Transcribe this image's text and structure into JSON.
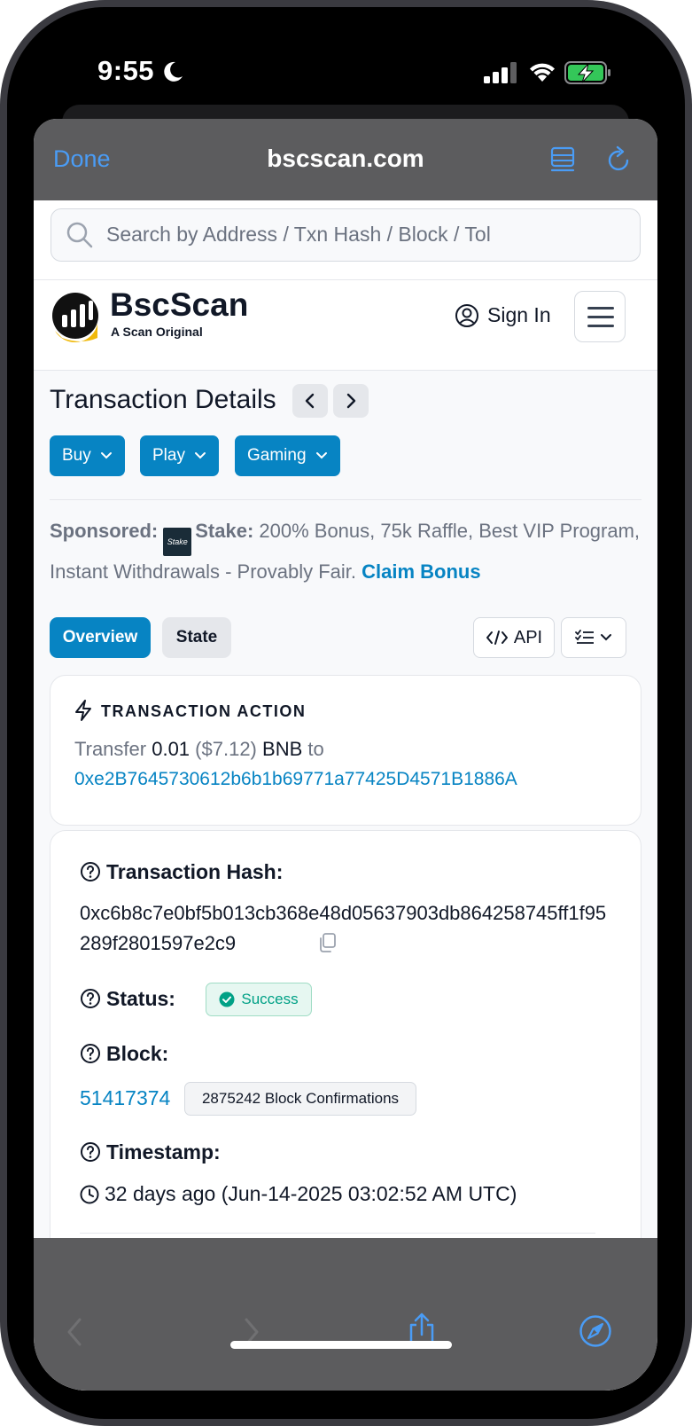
{
  "status_bar": {
    "time": "9:55"
  },
  "browser": {
    "done_label": "Done",
    "url": "bscscan.com"
  },
  "search": {
    "placeholder": "Search by Address / Txn Hash / Block / Tol"
  },
  "header": {
    "logo_title": "BscScan",
    "logo_subtitle": "A Scan Original",
    "sign_in_label": "Sign In"
  },
  "page": {
    "title": "Transaction Details",
    "menu_buttons": [
      {
        "label": "Buy"
      },
      {
        "label": "Play"
      },
      {
        "label": "Gaming"
      }
    ]
  },
  "sponsored": {
    "label": "Sponsored:",
    "brand": "Stake:",
    "logo_text": "Stake",
    "text": " 200% Bonus, 75k Raffle, Best VIP Program, Instant Withdrawals - Provably Fair. ",
    "cta": "Claim Bonus"
  },
  "tabs": {
    "overview": "Overview",
    "state": "State",
    "api": "API"
  },
  "transaction_action": {
    "title": "TRANSACTION ACTION",
    "verb": "Transfer",
    "amount": "0.01",
    "usd": "($7.12)",
    "token": "BNB",
    "to": "to",
    "address": "0xe2B7645730612b6b1b69771a77425D4571B1886A"
  },
  "details": {
    "hash_label": "Transaction Hash:",
    "hash": "0xc6b8c7e0bf5b013cb368e48d05637903db864258745ff1f95289f2801597e2c9",
    "status_label": "Status:",
    "status_value": "Success",
    "block_label": "Block:",
    "block_value": "51417374",
    "confirmations": "2875242 Block Confirmations",
    "timestamp_label": "Timestamp:",
    "timestamp_value": "32 days ago (Jun-14-2025 03:02:52 AM UTC)"
  },
  "colors": {
    "accent": "#0784c3",
    "success": "#00a186",
    "ios_blue": "#4a9cf5"
  }
}
